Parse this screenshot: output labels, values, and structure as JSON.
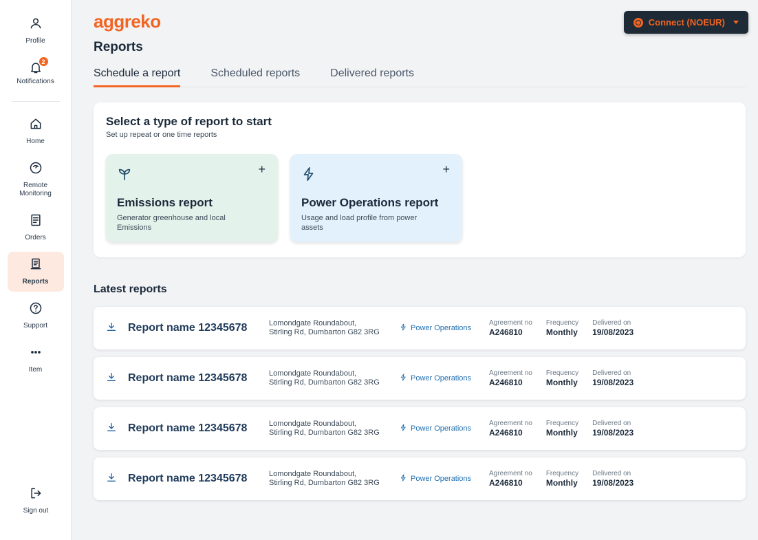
{
  "brand": {
    "logo_text": "aggreko",
    "accent": "#f26522"
  },
  "sidebar": {
    "profile": {
      "label": "Profile"
    },
    "notifications": {
      "label": "Notifications",
      "badge": "2"
    },
    "items": [
      {
        "label": "Home",
        "icon": "home-icon"
      },
      {
        "label": "Remote Monitoring",
        "icon": "gauge-icon"
      },
      {
        "label": "Orders",
        "icon": "document-icon"
      },
      {
        "label": "Reports",
        "icon": "report-icon"
      },
      {
        "label": "Support",
        "icon": "help-icon"
      },
      {
        "label": "Item",
        "icon": "more-icon"
      }
    ],
    "signout": {
      "label": "Sign out"
    }
  },
  "header": {
    "title": "Reports",
    "connect_label": "Connect (NOEUR)"
  },
  "tabs": [
    {
      "label": "Schedule a report"
    },
    {
      "label": "Scheduled reports"
    },
    {
      "label": "Delivered reports"
    }
  ],
  "select_section": {
    "title": "Select a type of report to start",
    "subtitle": "Set up repeat or one time reports",
    "cards": [
      {
        "title": "Emissions report",
        "description": "Generator greenhouse and local Emissions",
        "action": "+"
      },
      {
        "title": "Power Operations report",
        "description": "Usage and load profile from power assets",
        "action": "+"
      }
    ]
  },
  "latest": {
    "title": "Latest reports",
    "labels": {
      "agreement": "Agreement no",
      "frequency": "Frequency",
      "delivered": "Delivered on"
    },
    "rows": [
      {
        "name": "Report name 12345678",
        "address_line1": "Lomondgate Roundabout,",
        "address_line2": "Stirling Rd, Dumbarton G82 3RG",
        "type": "Power Operations",
        "agreement": "A246810",
        "frequency": "Monthly",
        "delivered": "19/08/2023"
      },
      {
        "name": "Report name 12345678",
        "address_line1": "Lomondgate Roundabout,",
        "address_line2": "Stirling Rd, Dumbarton G82 3RG",
        "type": "Power Operations",
        "agreement": "A246810",
        "frequency": "Monthly",
        "delivered": "19/08/2023"
      },
      {
        "name": "Report name 12345678",
        "address_line1": "Lomondgate Roundabout,",
        "address_line2": "Stirling Rd, Dumbarton G82 3RG",
        "type": "Power Operations",
        "agreement": "A246810",
        "frequency": "Monthly",
        "delivered": "19/08/2023"
      },
      {
        "name": "Report name 12345678",
        "address_line1": "Lomondgate Roundabout,",
        "address_line2": "Stirling Rd, Dumbarton G82 3RG",
        "type": "Power Operations",
        "agreement": "A246810",
        "frequency": "Monthly",
        "delivered": "19/08/2023"
      }
    ]
  }
}
